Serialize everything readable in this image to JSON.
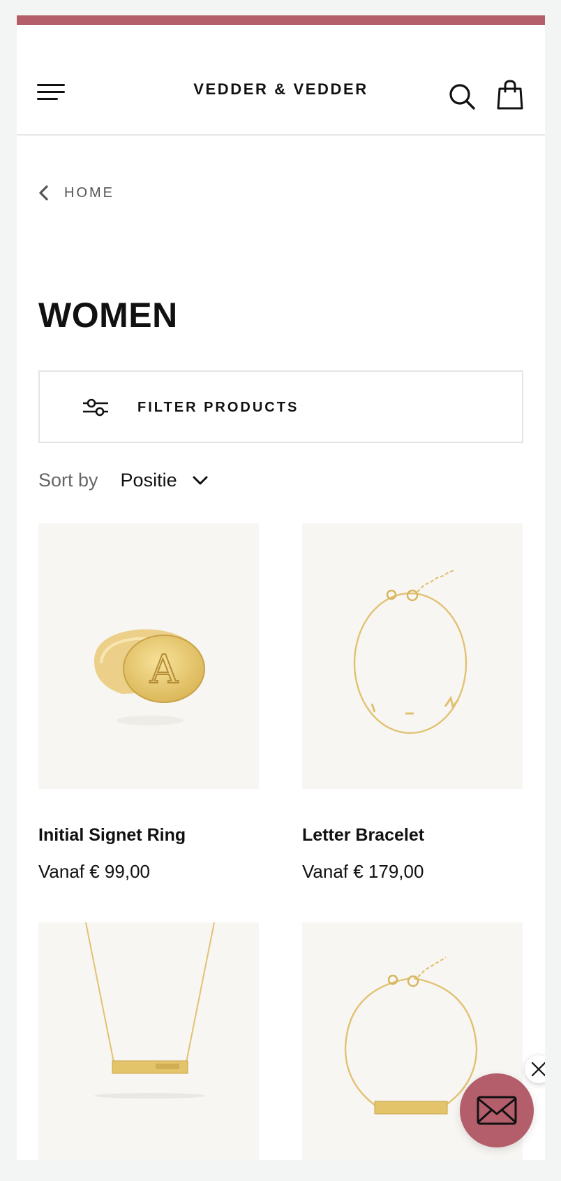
{
  "header": {
    "brand": "VEDDER & VEDDER"
  },
  "breadcrumb": {
    "label": "HOME"
  },
  "page_title": "WOMEN",
  "filter": {
    "label": "FILTER PRODUCTS"
  },
  "sort": {
    "label": "Sort by",
    "value": "Positie"
  },
  "products": [
    {
      "name": "Initial Signet Ring",
      "price": "Vanaf € 99,00"
    },
    {
      "name": "Letter Bracelet",
      "price": "Vanaf € 179,00"
    },
    {
      "name": "",
      "price": ""
    },
    {
      "name": "",
      "price": ""
    }
  ],
  "colors": {
    "accent": "#b45e6c",
    "product_bg": "#f7f6f2",
    "gold": "#e2c272"
  },
  "icons": [
    "menu-icon",
    "search-icon",
    "shopping-bag-icon",
    "chevron-left-icon",
    "filter-sliders-icon",
    "chevron-down-icon",
    "envelope-icon",
    "close-icon"
  ]
}
